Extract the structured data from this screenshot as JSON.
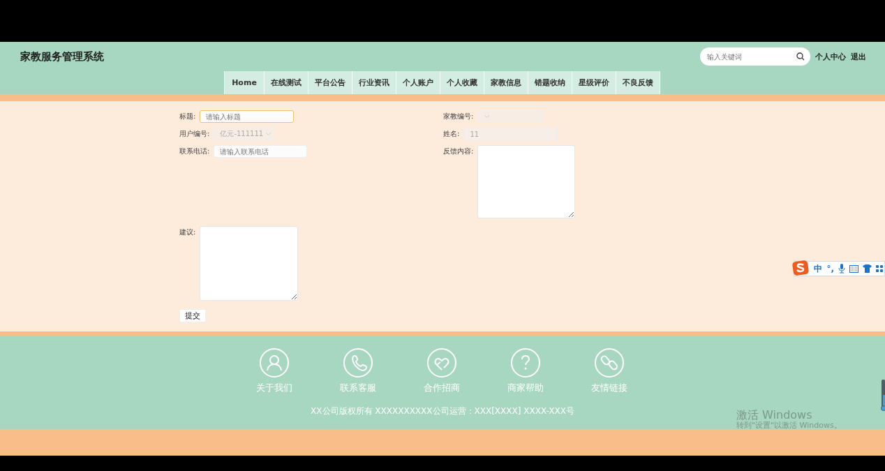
{
  "header": {
    "title": "家教服务管理系统",
    "search": {
      "placeholder": "输入关键词"
    },
    "links": [
      "个人中心",
      "退出"
    ]
  },
  "nav": [
    "Home",
    "在线测试",
    "平台公告",
    "行业资讯",
    "个人账户",
    "个人收藏",
    "家教信息",
    "错题收纳",
    "星级评价",
    "不良反馈"
  ],
  "form": {
    "left": [
      {
        "label": "标题:",
        "kind": "input",
        "placeholder": "请输入标题",
        "focused": true,
        "disabled": false
      },
      {
        "label": "用户编号:",
        "kind": "select",
        "value": "亿元-111111",
        "focused": false,
        "disabled": true
      },
      {
        "label": "联系电话:",
        "kind": "input",
        "placeholder": "请输入联系电话",
        "focused": false,
        "disabled": false
      }
    ],
    "right": [
      {
        "label": "家教编号:",
        "kind": "select",
        "focused": false,
        "disabled": true
      },
      {
        "label": "姓名:",
        "kind": "input",
        "value": "11",
        "focused": false,
        "disabled": true
      },
      {
        "label": "反馈内容:",
        "kind": "textarea",
        "focused": false,
        "disabled": false
      }
    ],
    "suggestion": {
      "label": "建议:"
    },
    "submit": "提交"
  },
  "footer": {
    "links": [
      {
        "kind": "user",
        "label": "关于我们"
      },
      {
        "kind": "phone",
        "label": "联系客服"
      },
      {
        "kind": "heart",
        "label": "合作招商"
      },
      {
        "kind": "help",
        "label": "商家帮助"
      },
      {
        "kind": "link",
        "label": "友情链接"
      }
    ],
    "copyright": "XX公司版权所有 XXXXXXXXXX公司运营：XXX[XXXX] XXXX-XXX号"
  },
  "ime": {
    "mode": "中",
    "punct": "°,"
  },
  "activation": {
    "title": "激活 Windows",
    "subtitle": "转到\"设置\"以激活 Windows。"
  }
}
